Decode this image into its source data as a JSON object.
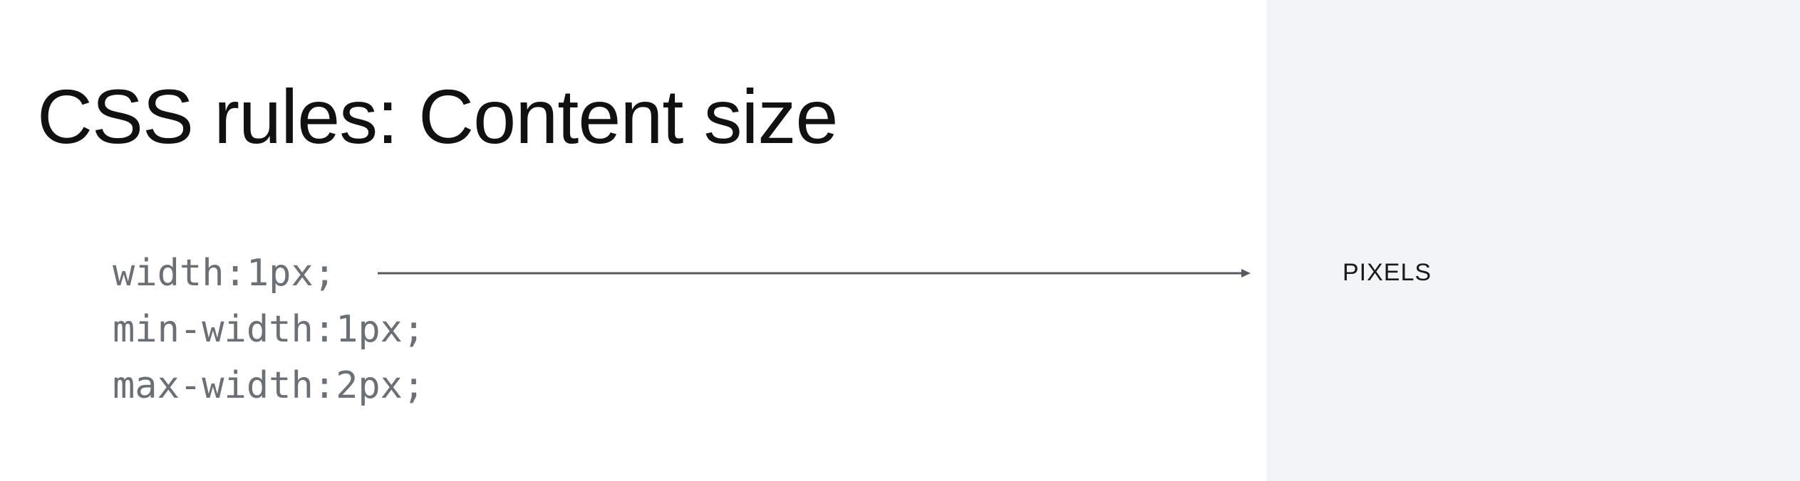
{
  "slide": {
    "title": "CSS rules: Content size",
    "code_lines": [
      "width:1px;",
      "min-width:1px;",
      "max-width:2px;"
    ],
    "unit_label": "PIXELS",
    "colors": {
      "background": "#ffffff",
      "panel": "#f3f4f7",
      "title": "#111111",
      "code": "#6b6f76",
      "arrow": "#555a61"
    }
  }
}
